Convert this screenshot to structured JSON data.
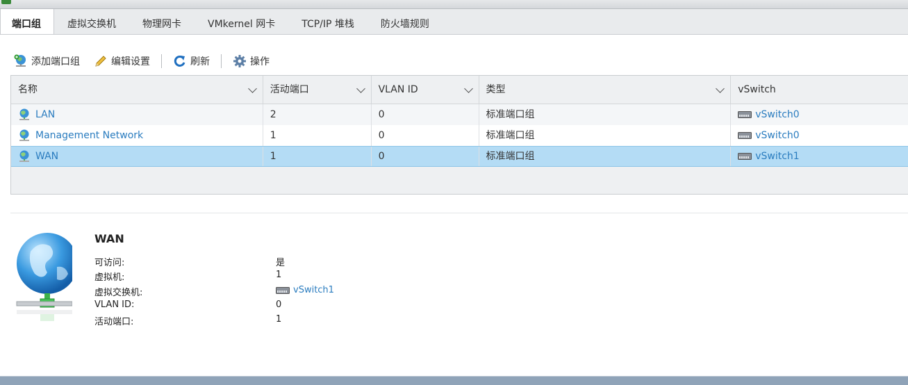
{
  "tabs": [
    {
      "label": "端口组",
      "active": true
    },
    {
      "label": "虚拟交换机"
    },
    {
      "label": "物理网卡"
    },
    {
      "label": "VMkernel 网卡"
    },
    {
      "label": "TCP/IP 堆栈"
    },
    {
      "label": "防火墙规则"
    }
  ],
  "toolbar": {
    "add_port_group": "添加端口组",
    "edit_settings": "编辑设置",
    "refresh": "刷新",
    "actions": "操作"
  },
  "table": {
    "columns": [
      "名称",
      "活动端口",
      "VLAN ID",
      "类型",
      "vSwitch"
    ],
    "rows": [
      {
        "name": "LAN",
        "active_ports": "2",
        "vlan_id": "0",
        "type": "标准端口组",
        "vswitch": "vSwitch0"
      },
      {
        "name": "Management Network",
        "active_ports": "1",
        "vlan_id": "0",
        "type": "标准端口组",
        "vswitch": "vSwitch0"
      },
      {
        "name": "WAN",
        "active_ports": "1",
        "vlan_id": "0",
        "type": "标准端口组",
        "vswitch": "vSwitch1",
        "selected": true
      }
    ]
  },
  "detail": {
    "title": "WAN",
    "fields": [
      {
        "label": "可访问:",
        "value": "是"
      },
      {
        "label": "虚拟机:",
        "value": "1"
      },
      {
        "label": "虚拟交换机:",
        "value": "vSwitch1",
        "link": true
      },
      {
        "label": "VLAN ID:",
        "value": "0"
      },
      {
        "label": "活动端口:",
        "value": "1"
      }
    ]
  },
  "colors": {
    "link": "#2a7cbf",
    "selected_row": "#b4dcf5"
  },
  "icons": [
    "network-globe-icon",
    "pencil-icon",
    "refresh-icon",
    "gear-icon",
    "vswitch-icon",
    "chevron-down-icon"
  ]
}
